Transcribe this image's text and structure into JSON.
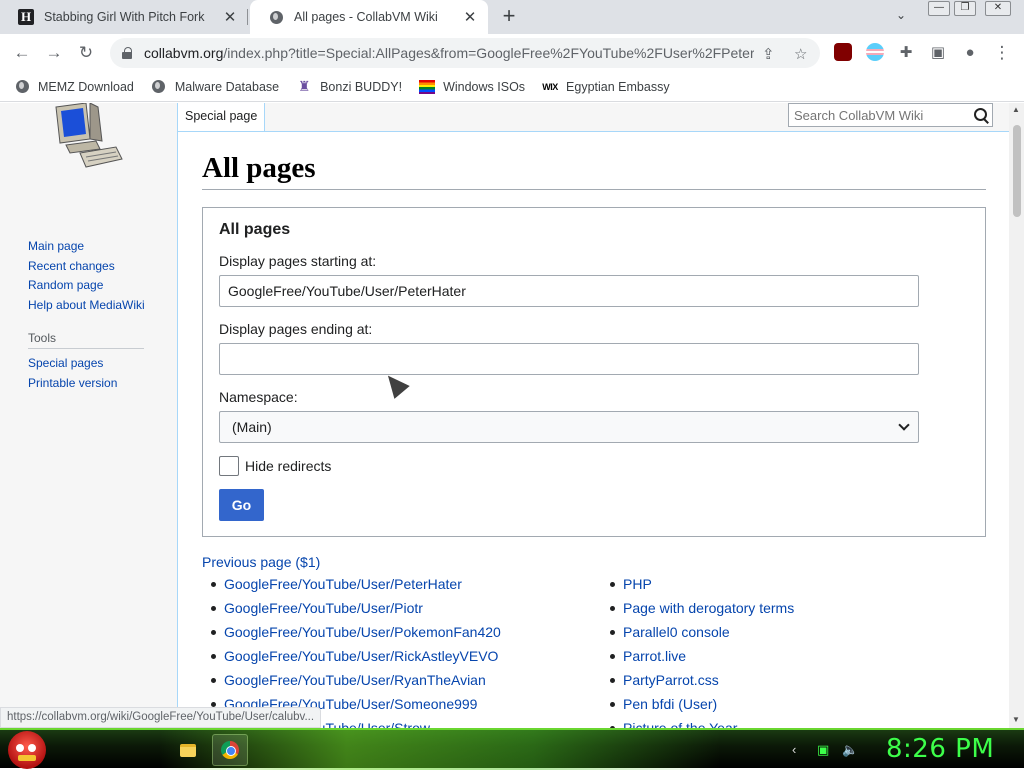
{
  "tabs": [
    {
      "title": "Stabbing Girl With Pitch Fork",
      "favicon": "H",
      "active": false
    },
    {
      "title": "All pages - CollabVM Wiki",
      "active": true
    }
  ],
  "address": {
    "domain": "collabvm.org",
    "path": "/index.php?title=Special:AllPages&from=GoogleFree%2FYouTube%2FUser%2FPeter..."
  },
  "bookmarks": [
    {
      "label": "MEMZ Download",
      "icon": "globe-icon"
    },
    {
      "label": "Malware Database",
      "icon": "globe-icon"
    },
    {
      "label": "Bonzi BUDDY!",
      "icon": "bonzi-icon"
    },
    {
      "label": "Windows ISOs",
      "icon": "rainbow-flag-icon"
    },
    {
      "label": "Egyptian Embassy",
      "icon": "wix-icon",
      "icon_text": "WIX"
    }
  ],
  "sidebar": {
    "nav": [
      "Main page",
      "Recent changes",
      "Random page",
      "Help about MediaWiki"
    ],
    "tools_heading": "Tools",
    "tools": [
      "Special pages",
      "Printable version"
    ]
  },
  "page_tab": "Special page",
  "search": {
    "placeholder": "Search CollabVM Wiki"
  },
  "heading": "All pages",
  "form": {
    "legend": "All pages",
    "from_label": "Display pages starting at:",
    "from_value": "GoogleFree/YouTube/User/PeterHater",
    "to_label": "Display pages ending at:",
    "to_value": "",
    "namespace_label": "Namespace:",
    "namespace_value": "(Main)",
    "hide_redirects_label": "Hide redirects",
    "hide_redirects_checked": false,
    "go_label": "Go"
  },
  "previous_page": "Previous page ($1)",
  "pages_left": [
    "GoogleFree/YouTube/User/PeterHater",
    "GoogleFree/YouTube/User/Piotr",
    "GoogleFree/YouTube/User/PokemonFan420",
    "GoogleFree/YouTube/User/RickAstleyVEVO",
    "GoogleFree/YouTube/User/RyanTheAvian",
    "GoogleFree/YouTube/User/Someone999",
    "GoogleFree/YouTube/User/Strow"
  ],
  "pages_right": [
    "PHP",
    "Page with derogatory terms",
    "Parallel0 console",
    "Parrot.live",
    "PartyParrot.css",
    "Pen bfdi (User)",
    "Picture of the Year"
  ],
  "status_url": "https://collabvm.org/wiki/GoogleFree/YouTube/User/calubv...",
  "taskbar": {
    "clock": "8:26 PM"
  },
  "colors": {
    "link": "#0645ad",
    "button": "#3366cc",
    "clock": "#3dff4a",
    "tab_bar": "#dee1e6"
  }
}
